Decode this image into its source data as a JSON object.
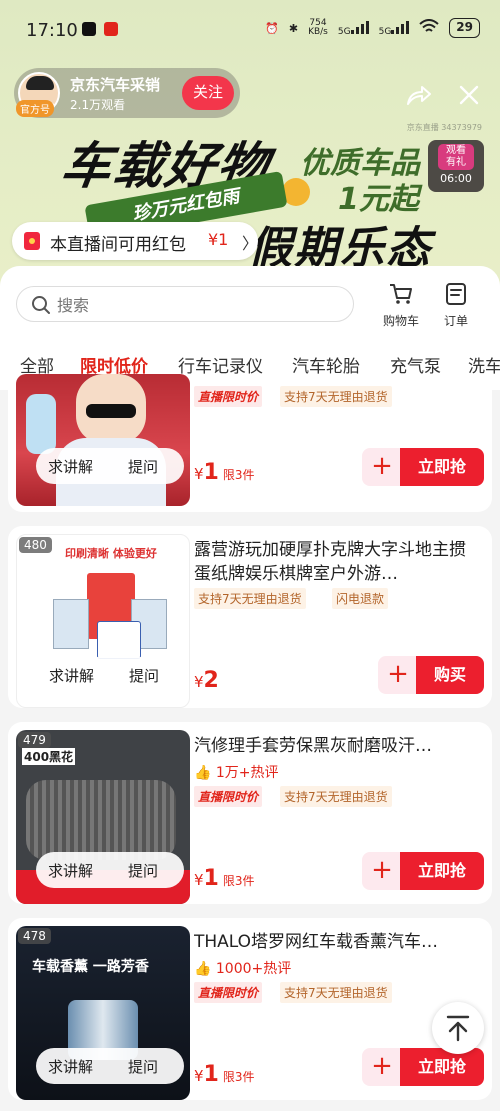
{
  "status_bar": {
    "time": "17:10",
    "net_speed": "754",
    "net_unit": "KB/s",
    "sim1": "5G",
    "sim2": "5G",
    "battery": "29"
  },
  "host": {
    "name": "京东汽车采销",
    "tag": "官方号",
    "views": "2.1万观看",
    "follow_label": "关注"
  },
  "banner": {
    "title1": "车载好物",
    "title2": "优质车品",
    "title3": "1元起",
    "ribbon": "珍万元红包雨",
    "bottom": "假期乐态",
    "room_id": "京东直播 34373979",
    "watch": {
      "line1": "观看",
      "line2": "有礼",
      "time": "06:00"
    }
  },
  "red_packet": {
    "text": "本直播间可用红包",
    "amount": "¥1",
    "arrow": "〉"
  },
  "search": {
    "placeholder": "搜索"
  },
  "header_actions": {
    "cart": "购物车",
    "orders": "订单"
  },
  "tabs": [
    "全部",
    "限时低价",
    "行车记录仪",
    "汽车轮胎",
    "充气泵",
    "洗车"
  ],
  "ask": {
    "explain": "求讲解",
    "question": "提问"
  },
  "products": [
    {
      "num": "",
      "title": "",
      "tags": [
        "直播限时价",
        "支持7天无理由退货"
      ],
      "price": "1",
      "limit": "限3件",
      "button": "立即抢"
    },
    {
      "num": "480",
      "title": "露营游玩加硬厚扑克牌大字斗地主掼蛋纸牌娱乐棋牌室户外游…",
      "tags": [
        "支持7天无理由退货",
        "闪电退款"
      ],
      "price": "2",
      "limit": "",
      "button": "购买",
      "img_text": "印刷清晰 体验更好"
    },
    {
      "num": "479",
      "title": "汽修理手套劳保黑灰耐磨吸汗…",
      "hot": "1万+热评",
      "tags": [
        "直播限时价",
        "支持7天无理由退货"
      ],
      "price": "1",
      "limit": "限3件",
      "button": "立即抢",
      "img_text": "400黑花"
    },
    {
      "num": "478",
      "title": "THALO塔罗网红车载香薰汽车…",
      "hot": "1000+热评",
      "tags": [
        "直播限时价",
        "支持7天无理由退货"
      ],
      "price": "1",
      "limit": "限3件",
      "button": "立即抢",
      "img_text": "车载香薰 一路芳香"
    }
  ],
  "colors": {
    "accent": "#e1251b",
    "banner_bg": "#e3ecc5",
    "buy_button": "#ec1f2e"
  }
}
